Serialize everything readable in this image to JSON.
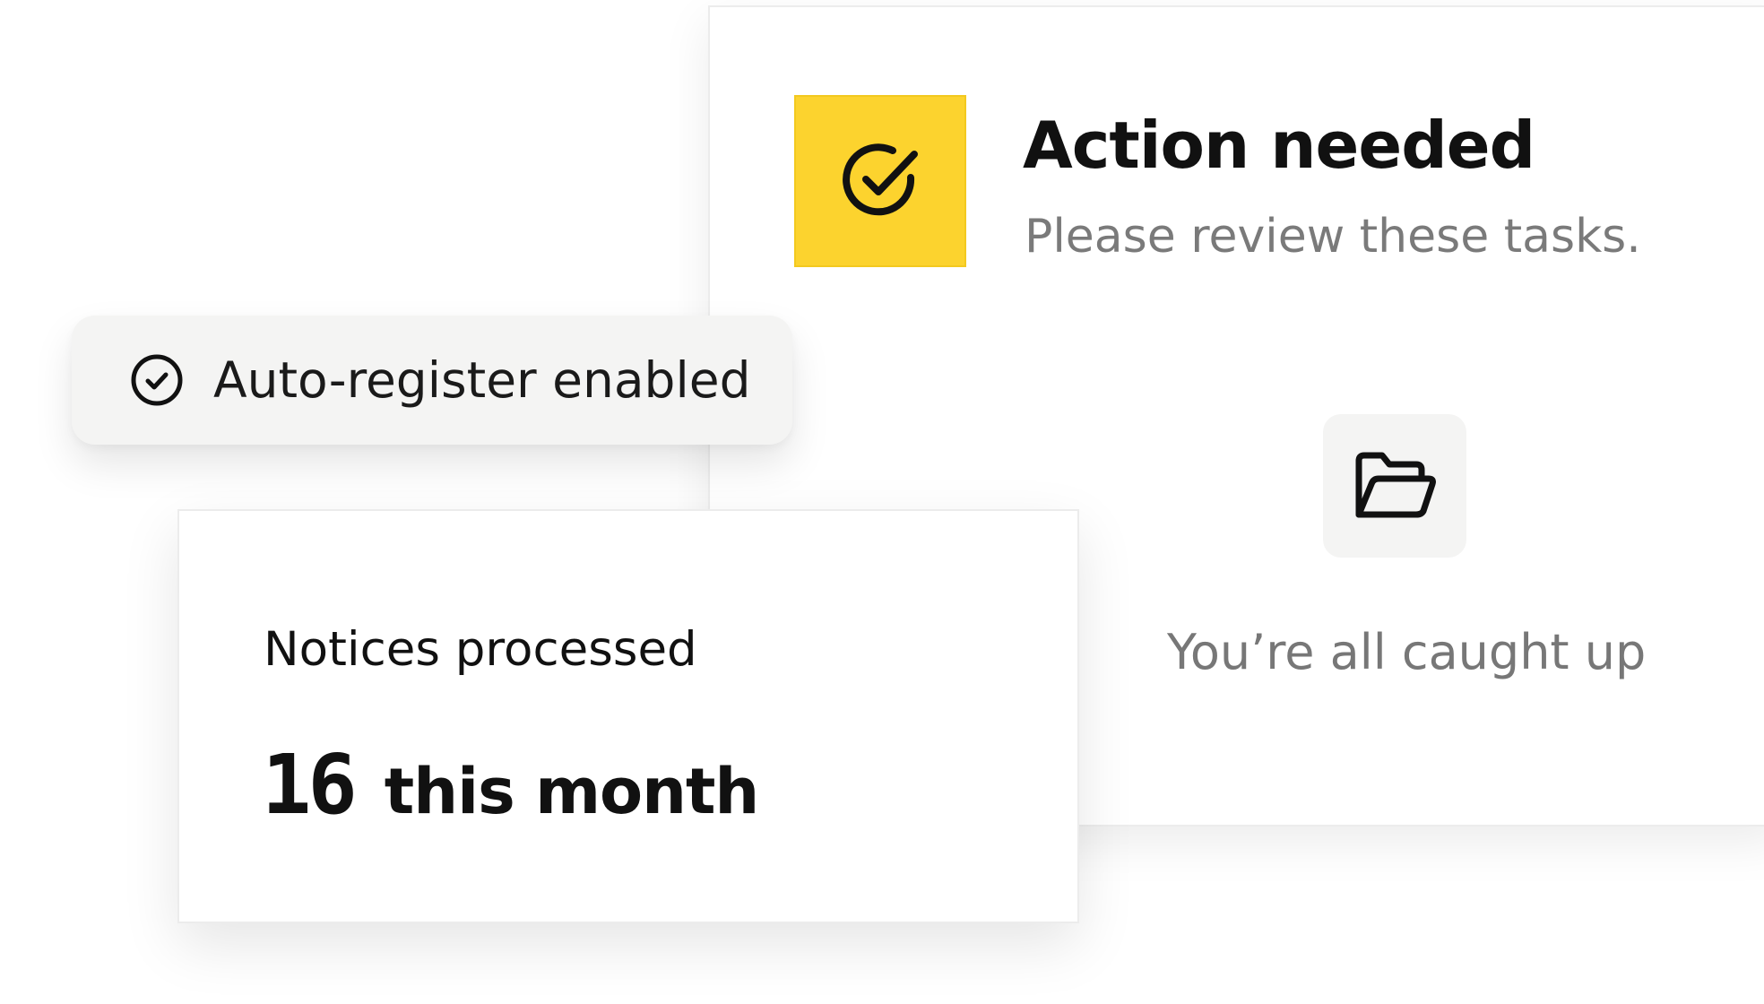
{
  "action_card": {
    "title": "Action needed",
    "subtitle": "Please review these tasks.",
    "icon": "check-circle-icon",
    "accent_color": "#fcd32e",
    "empty_state": {
      "icon": "folder-open-icon",
      "text": "You’re all caught up"
    }
  },
  "auto_register": {
    "icon": "check-circle-icon",
    "label": "Auto-register enabled"
  },
  "notices": {
    "label": "Notices processed",
    "count": "16",
    "period": "this month"
  }
}
